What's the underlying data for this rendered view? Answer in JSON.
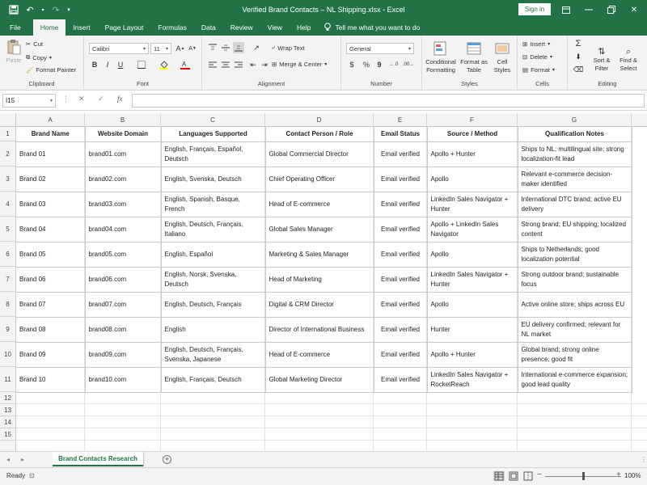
{
  "titlebar": {
    "title": "Verified Brand Contacts – NL Shipping.xlsx  -  Excel",
    "signin": "Sign in"
  },
  "menu": {
    "items": [
      "File",
      "Home",
      "Insert",
      "Page Layout",
      "Formulas",
      "Data",
      "Review",
      "View",
      "Help"
    ],
    "active": "Home",
    "tellme": "Tell me what you want to do"
  },
  "ribbon": {
    "clipboard": {
      "paste": "Paste",
      "cut": "Cut",
      "copy": "Copy",
      "format_painter": "Format Painter",
      "label": "Clipboard"
    },
    "font": {
      "name": "Calibri",
      "size": "11",
      "bold": "B",
      "italic": "I",
      "underline": "U",
      "label": "Font"
    },
    "alignment": {
      "wrap": "Wrap Text",
      "merge": "Merge & Center",
      "label": "Alignment"
    },
    "number": {
      "format": "General",
      "currency": "$",
      "percent": "%",
      "comma": "9",
      "label": "Number"
    },
    "styles": {
      "conditional": "Conditional Formatting",
      "format_table": "Format as Table",
      "cell_styles": "Cell Styles",
      "label": "Styles"
    },
    "cells": {
      "insert": "Insert",
      "delete": "Delete",
      "format": "Format",
      "label": "Cells"
    },
    "editing": {
      "sort": "Sort & Filter",
      "find": "Find & Select",
      "label": "Editing"
    }
  },
  "formula_bar": {
    "name_box": "I15",
    "fx": "fx",
    "value": ""
  },
  "sheet": {
    "columns": [
      "A",
      "B",
      "C",
      "D",
      "E",
      "F",
      "G"
    ],
    "headers": [
      "Brand Name",
      "Website Domain",
      "Languages Supported",
      "Contact Person / Role",
      "Email Status",
      "Source / Method",
      "Qualification Notes"
    ],
    "rows": [
      [
        "Brand 01",
        "brand01.com",
        "English, Français, Español, Deutsch",
        "Global Commercial Director",
        "Email verified",
        "Apollo + Hunter",
        "Ships to NL; multilingual site; strong localization-fit lead"
      ],
      [
        "Brand 02",
        "brand02.com",
        "English, Svenska, Deutsch",
        "Chief Operating Officer",
        "Email verified",
        "Apollo",
        "Relevant e-commerce decision-maker identified"
      ],
      [
        "Brand 03",
        "brand03.com",
        "English, Spanish, Basque, French",
        "Head of E-commerce",
        "Email verified",
        "LinkedIn Sales Navigator + Hunter",
        "International DTC brand; active EU delivery"
      ],
      [
        "Brand 04",
        "brand04.com",
        "English, Deutsch, Français, Italiano",
        "Global Sales Manager",
        "Email verified",
        "Apollo + LinkedIn Sales Navigator",
        "Strong brand; EU shipping; localized content"
      ],
      [
        "Brand 05",
        "brand05.com",
        "English, Español",
        "Marketing & Sales Manager",
        "Email verified",
        "Apollo",
        "Ships to Netherlands; good localization potential"
      ],
      [
        "Brand 06",
        "brand06.com",
        "English, Norsk, Svenska, Deutsch",
        "Head of Marketing",
        "Email verified",
        "LinkedIn Sales Navigator + Hunter",
        "Strong outdoor brand; sustainable focus"
      ],
      [
        "Brand 07",
        "brand07.com",
        "English, Deutsch, Français",
        "Digital & CRM Director",
        "Email verified",
        "Apollo",
        "Active online store; ships across EU"
      ],
      [
        "Brand 08",
        "brand08.com",
        "English",
        "Director of International Business",
        "Email verified",
        "Hunter",
        "EU delivery confirmed; relevant for NL market"
      ],
      [
        "Brand 09",
        "brand09.com",
        "English, Deutsch, Français, Svenska, Japanese",
        "Head of E-commerce",
        "Email verified",
        "Apollo + Hunter",
        "Global brand; strong online presence; good fit"
      ],
      [
        "Brand 10",
        "brand10.com",
        "English, Français, Deutsch",
        "Global Marketing Director",
        "Email verified",
        "LinkedIn Sales Navigator + RocketReach",
        "International e-commerce expansion; good lead quality"
      ]
    ],
    "row_numbers": [
      "1",
      "2",
      "3",
      "4",
      "5",
      "6",
      "7",
      "8",
      "9",
      "10",
      "11",
      "12",
      "13",
      "14",
      "15"
    ]
  },
  "tabs": {
    "active": "Brand Contacts Research",
    "add": "+"
  },
  "status": {
    "ready": "Ready",
    "zoom": "100%"
  },
  "colors": {
    "accent": "#217346"
  }
}
